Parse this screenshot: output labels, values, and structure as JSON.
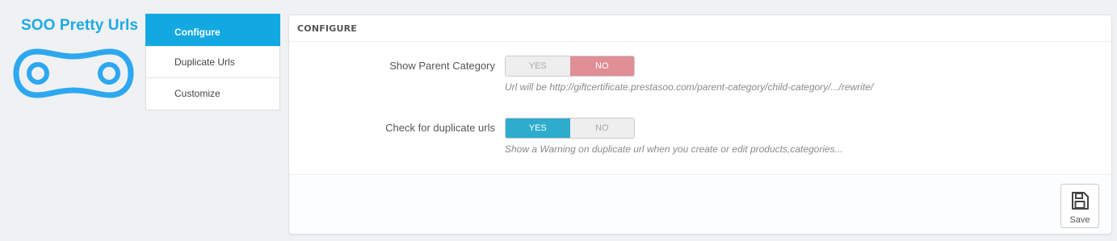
{
  "logo": {
    "title": "SOO Pretty Urls",
    "icon": "chain-link-icon",
    "color": "#1da9e6"
  },
  "tabs": [
    {
      "label": "Configure",
      "active": true
    },
    {
      "label": "Duplicate Urls",
      "active": false
    },
    {
      "label": "Customize",
      "active": false
    }
  ],
  "panel": {
    "heading": "CONFIGURE",
    "fields": [
      {
        "label": "Show Parent Category",
        "yes": "YES",
        "no": "NO",
        "value": "NO",
        "help": "Url will be http://giftcertificate.prestasoo.com/parent-category/child-category/.../rewrite/"
      },
      {
        "label": "Check for duplicate urls",
        "yes": "YES",
        "no": "NO",
        "value": "YES",
        "help": "Show a Warning on duplicate url when you create or edit products,categories..."
      }
    ],
    "save": {
      "label": "Save",
      "icon": "floppy-disk-icon"
    }
  },
  "colors": {
    "accent": "#12a9e3",
    "switch_yes": "#2eacce",
    "switch_no": "#e08f95"
  }
}
